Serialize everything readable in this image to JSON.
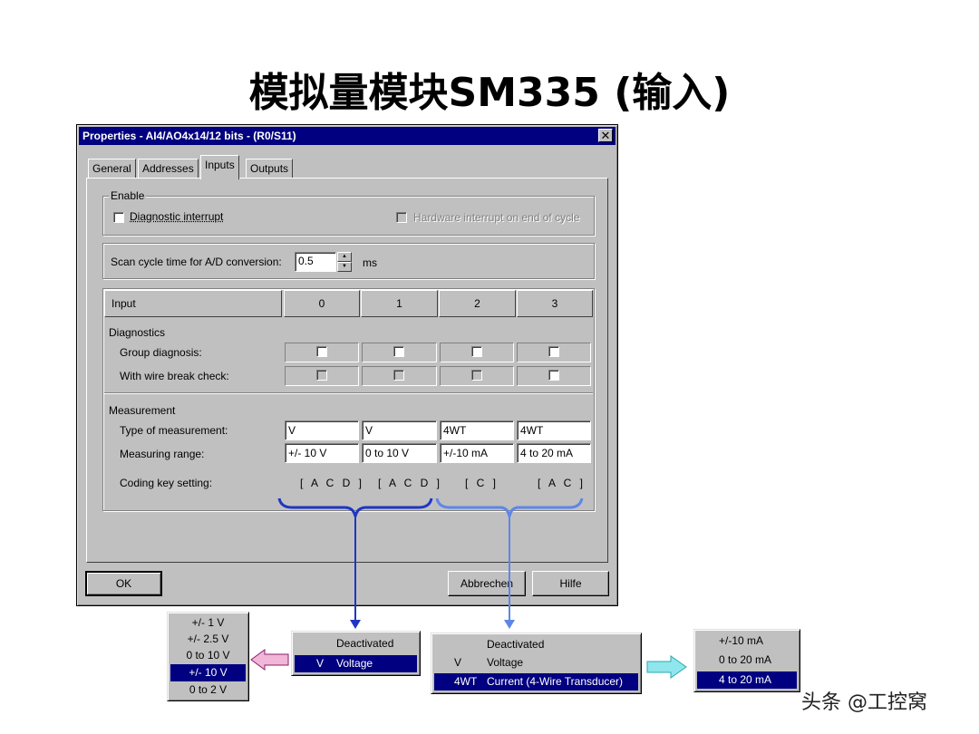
{
  "slide": {
    "title": "模拟量模块SM335 (输入)"
  },
  "dialog": {
    "title": "Properties - AI4/AO4x14/12 bits - (R0/S11)",
    "close_glyph": "✕",
    "tabs": [
      {
        "label": "General",
        "active": false
      },
      {
        "label": "Addresses",
        "active": false
      },
      {
        "label": "Inputs",
        "active": true
      },
      {
        "label": "Outputs",
        "active": false
      }
    ],
    "enable": {
      "legend": "Enable",
      "diagnostic_interrupt": "Diagnostic interrupt",
      "hardware_interrupt": "Hardware interrupt on end of cycle"
    },
    "scan": {
      "label": "Scan cycle time for A/D conversion:",
      "value": "0.5",
      "unit": "ms"
    },
    "table": {
      "header_label": "Input",
      "channels": [
        "0",
        "1",
        "2",
        "3"
      ],
      "diagnostics_section": "Diagnostics",
      "group_diagnosis": "Group diagnosis:",
      "wire_break": "With wire break check:",
      "measurement_section": "Measurement",
      "type_label": "Type of measurement:",
      "range_label": "Measuring range:",
      "coding_label": "Coding key setting:",
      "types": [
        "V",
        "V",
        "4WT",
        "4WT"
      ],
      "ranges": [
        "+/- 10 V",
        "0 to 10 V",
        "+/-10 mA",
        "4 to 20 mA"
      ],
      "coding": [
        "[ A C D ]",
        "[ A C D ]",
        "[ C ]",
        "[ A C ]"
      ]
    },
    "buttons": {
      "ok": "OK",
      "cancel": "Abbrechen",
      "help": "Hilfe"
    }
  },
  "popups": {
    "voltage_ranges": [
      "+/- 1 V",
      "+/- 2.5 V",
      "0 to 10 V",
      "+/- 10 V",
      "0 to 2 V"
    ],
    "voltage_ranges_selected": 3,
    "type_voltage": [
      {
        "code": "",
        "label": "Deactivated"
      },
      {
        "code": "V",
        "label": "Voltage"
      }
    ],
    "type_voltage_selected": 1,
    "type_current": [
      {
        "code": "",
        "label": "Deactivated"
      },
      {
        "code": "V",
        "label": "Voltage"
      },
      {
        "code": "4WT",
        "label": "Current (4-Wire Transducer)"
      }
    ],
    "type_current_selected": 2,
    "current_ranges": [
      "+/-10 mA",
      "0 to 20 mA",
      "4 to 20 mA"
    ],
    "current_ranges_selected": 2
  },
  "colors": {
    "bracket_dark": "#1f36c4",
    "bracket_light": "#5d86e8",
    "arrow_pink": "#f2b6d8",
    "arrow_cyan": "#8fe6ec",
    "selection": "#000080"
  },
  "watermark": "头条 @工控窝"
}
